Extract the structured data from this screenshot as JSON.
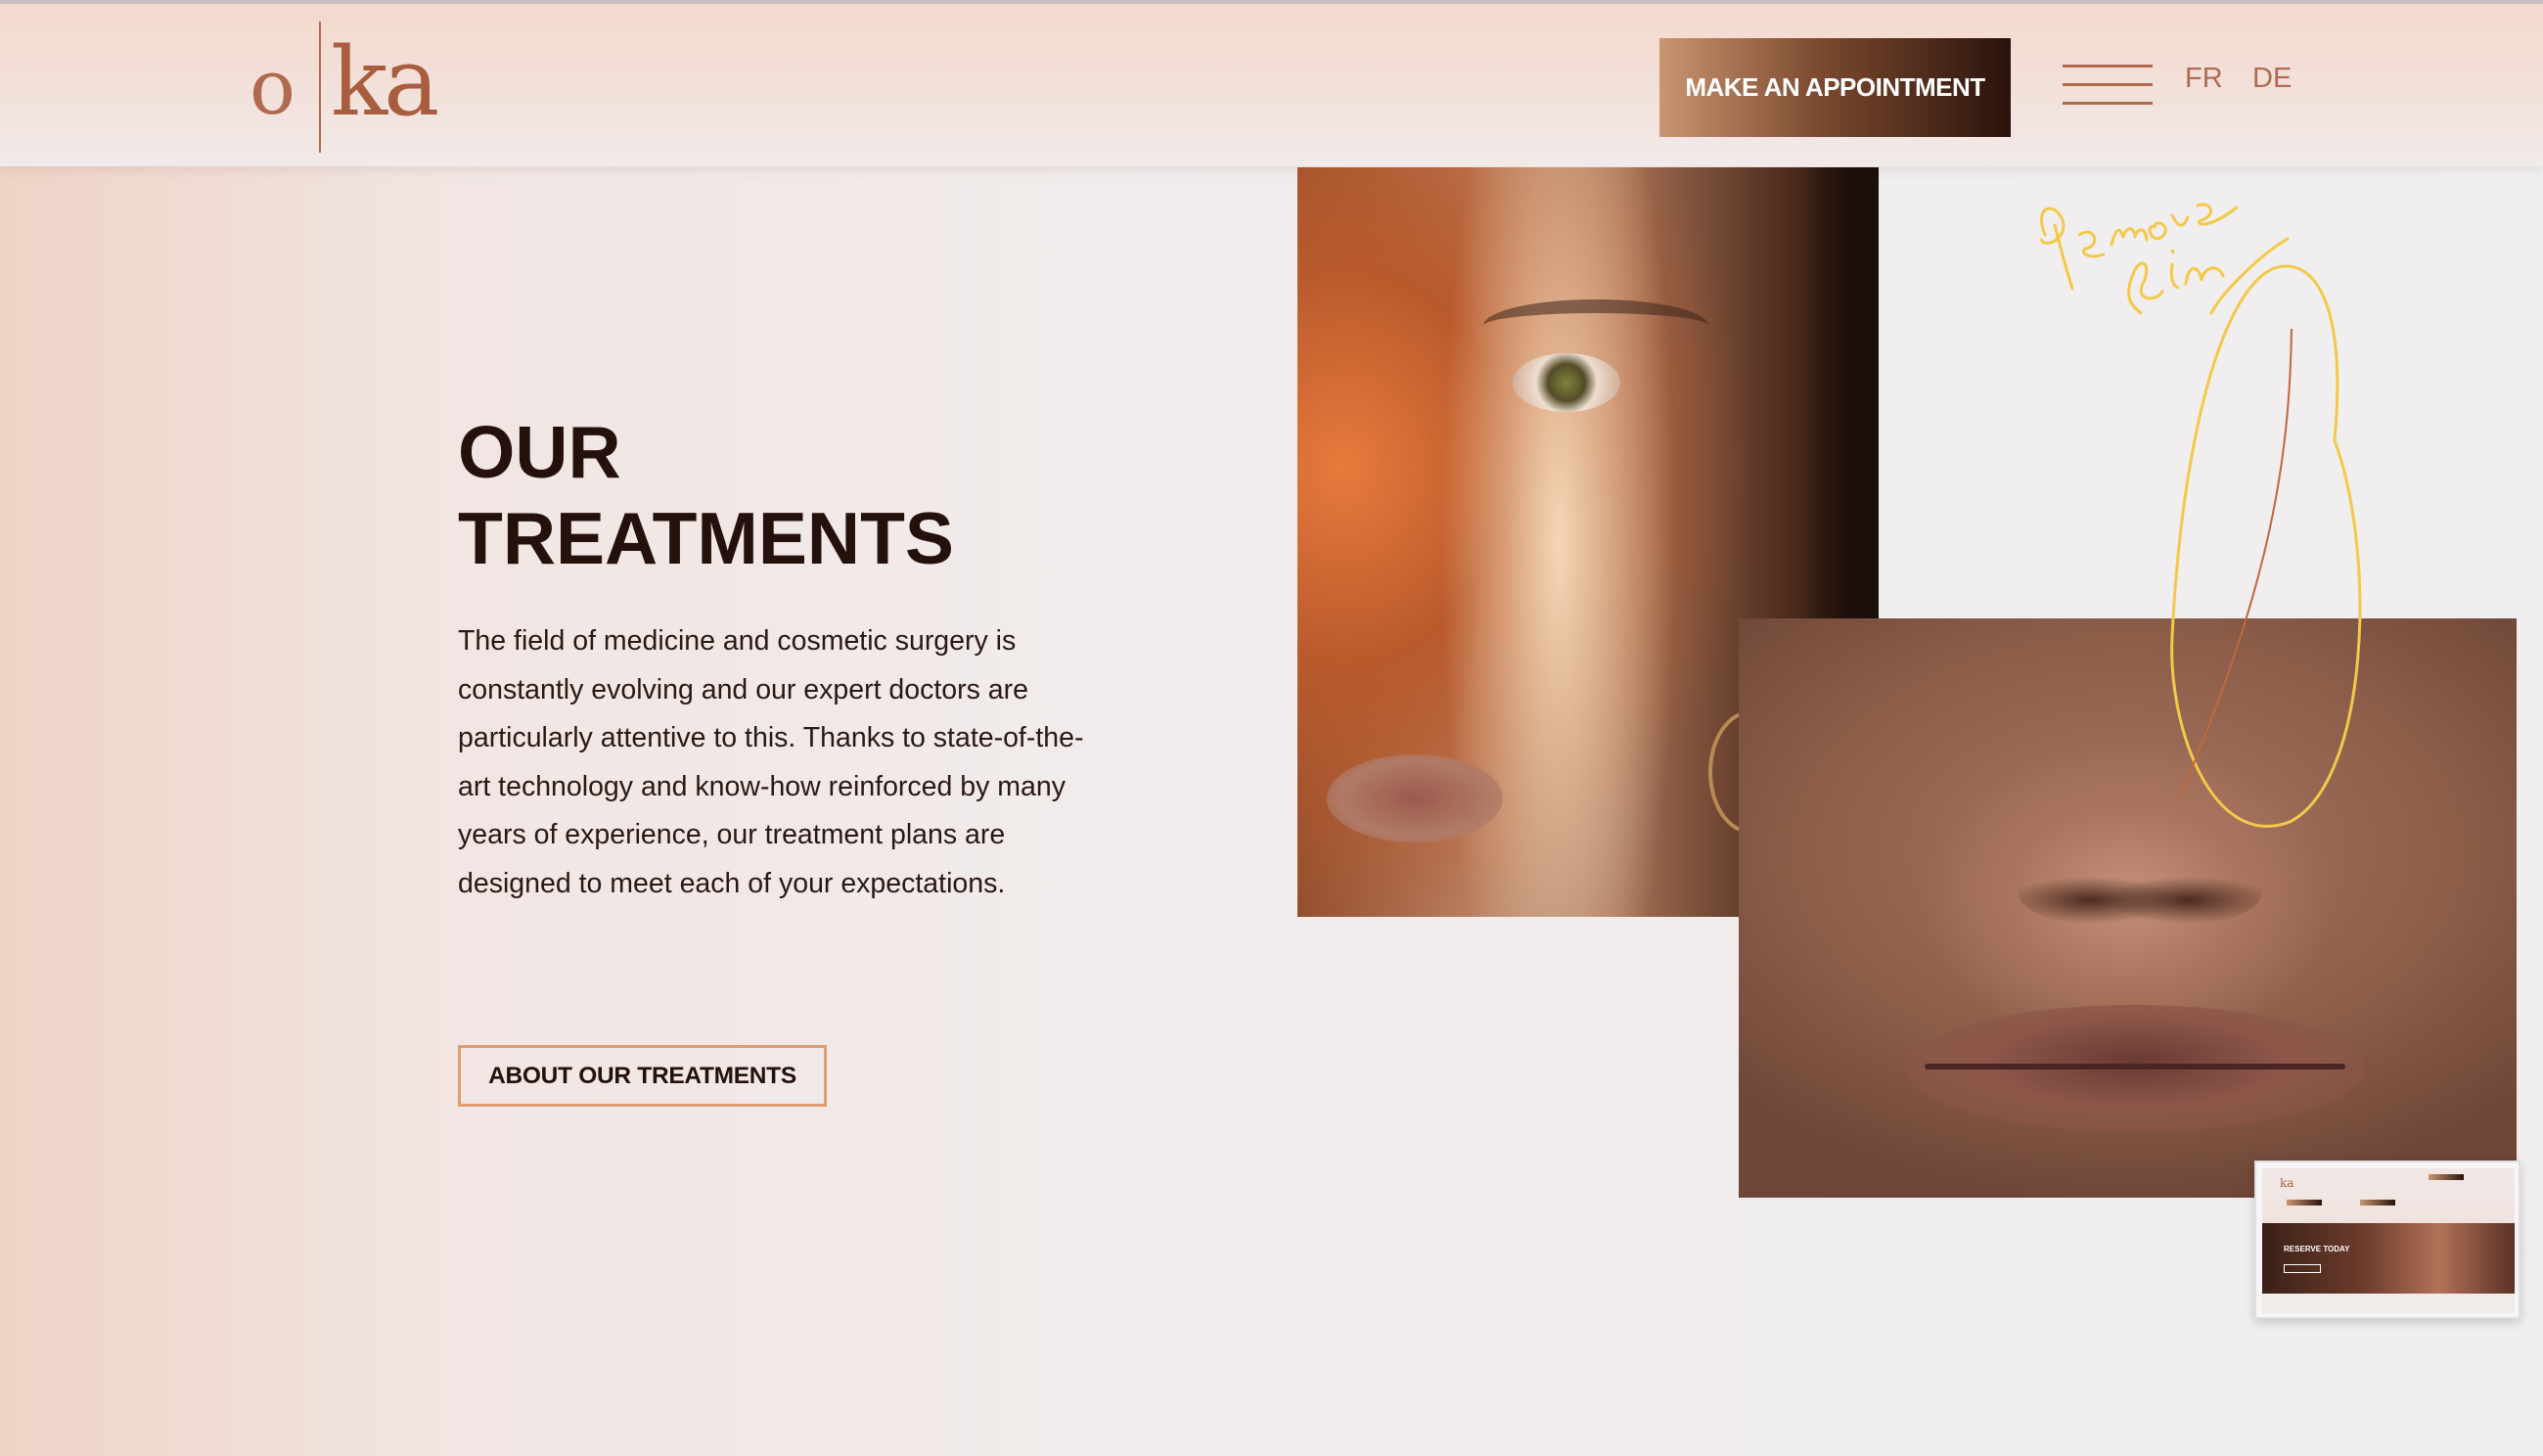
{
  "header": {
    "logo": {
      "mark_left": "o",
      "mark_right": "ka"
    },
    "appointment_label": "MAKE AN APPOINTMENT",
    "menu_icon": "hamburger-icon",
    "languages": [
      "FR",
      "DE"
    ]
  },
  "main": {
    "title_line1": "OUR",
    "title_line2": "TREATMENTS",
    "description": "The field of medicine and cosmetic surgery is constantly evolving and our expert doctors are particularly attentive to this. Thanks to state-of-the-art technology and know-how reinforced by many years of experience, our treatment plans are designed to meet each of your expectations.",
    "about_button_label": "ABOUT OUR TREATMENTS"
  },
  "annotation": {
    "handwritten_text": "Remove line",
    "color": "#f3c94a"
  },
  "thumbnail": {
    "label": "RESERVE TODAY"
  },
  "colors": {
    "accent": "#b06a4f",
    "dark": "#24110c",
    "button_border": "#dd9c72"
  }
}
